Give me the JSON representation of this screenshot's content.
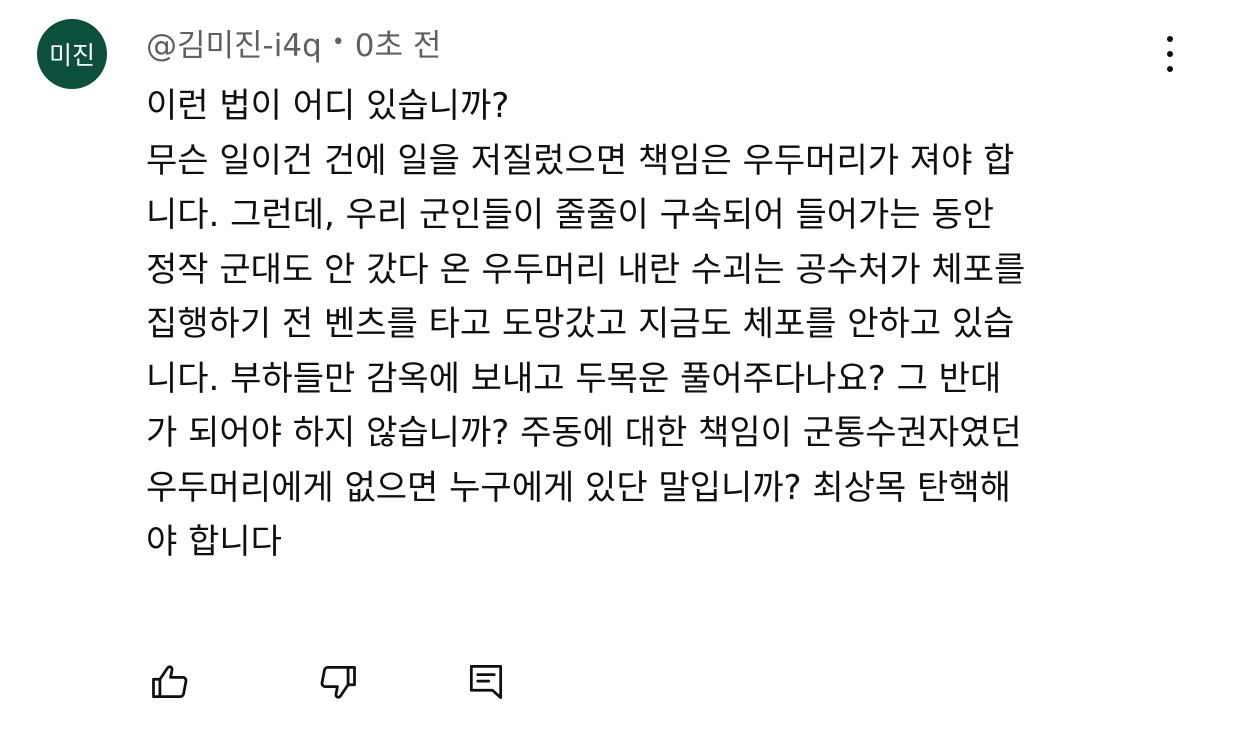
{
  "comment": {
    "avatar_text": "미진",
    "author": "@김미진-i4q",
    "separator": "•",
    "time": "0초 전",
    "text_lines": [
      "이런 법이 어디 있습니까?",
      "무슨 일이건 건에 일을 저질렀으면 책임은 우두머리가 져야 합",
      "니다. 그런데, 우리 군인들이 줄줄이 구속되어 들어가는 동안",
      "정작 군대도 안 갔다 온 우두머리 내란 수괴는 공수처가 체포를",
      "집행하기 전 벤츠를 타고 도망갔고 지금도 체포를 안하고 있습",
      "니다. 부하들만 감옥에 보내고 두목운 풀어주다나요? 그 반대",
      "가 되어야 하지 않습니까? 주동에 대한 책임이 군통수권자였던",
      "우두머리에게 없으면 누구에게 있단 말입니까? 최상목 탄핵해",
      "야 합니다"
    ]
  },
  "icons": {
    "menu": "more-vertical-icon",
    "like": "thumbs-up-icon",
    "dislike": "thumbs-down-icon",
    "reply": "comment-reply-icon"
  },
  "colors": {
    "avatar_bg": "#0b4f3c",
    "meta_text": "#606060",
    "body_text": "#0f0f0f"
  }
}
